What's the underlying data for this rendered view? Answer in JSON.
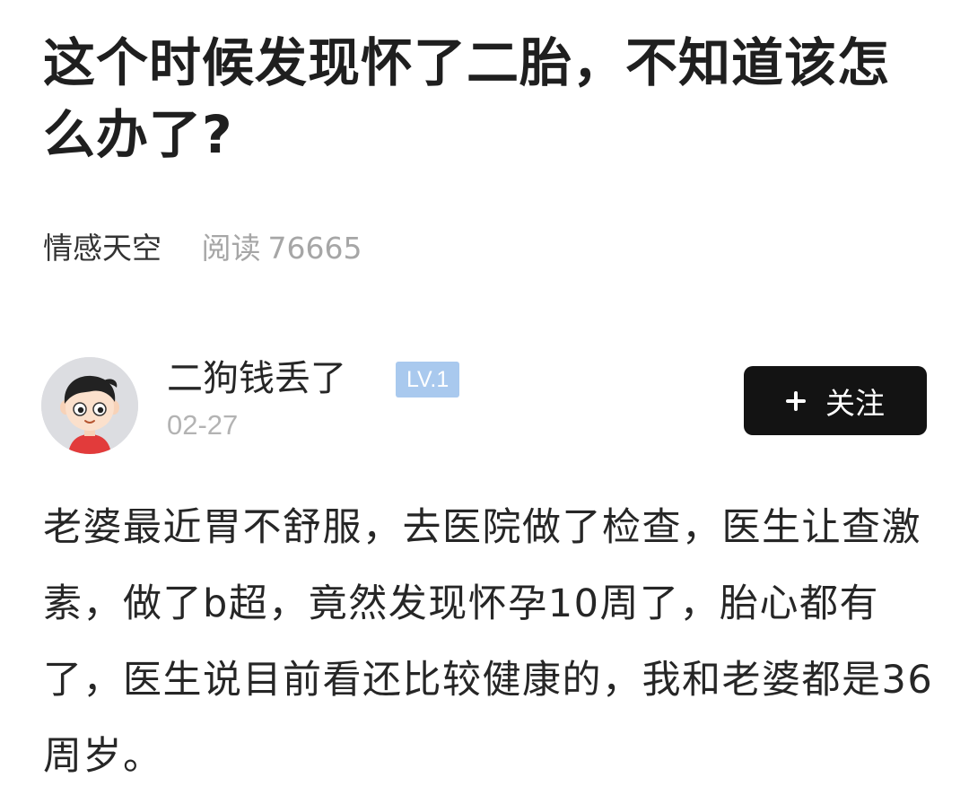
{
  "post": {
    "title": "这个时候发现怀了二胎，不知道该怎么办了?",
    "category": "情感天空",
    "reads_label": "阅读",
    "reads_count": "76665",
    "body": "老婆最近胃不舒服，去医院做了检查，医生让查激素，做了b超，竟然发现怀孕10周了，胎心都有了，医生说目前看还比较健康的，我和老婆都是36周岁。"
  },
  "author": {
    "name": "二狗钱丢了",
    "level": "LV.1",
    "date": "02-27",
    "avatar_icon": "cartoon-boy-avatar-icon"
  },
  "follow_button": {
    "label": "关注",
    "icon": "plus-icon"
  },
  "colors": {
    "follow_button_bg": "#131313",
    "level_badge_bg": "#a9c9ee",
    "muted_text": "#a6a6a6"
  }
}
